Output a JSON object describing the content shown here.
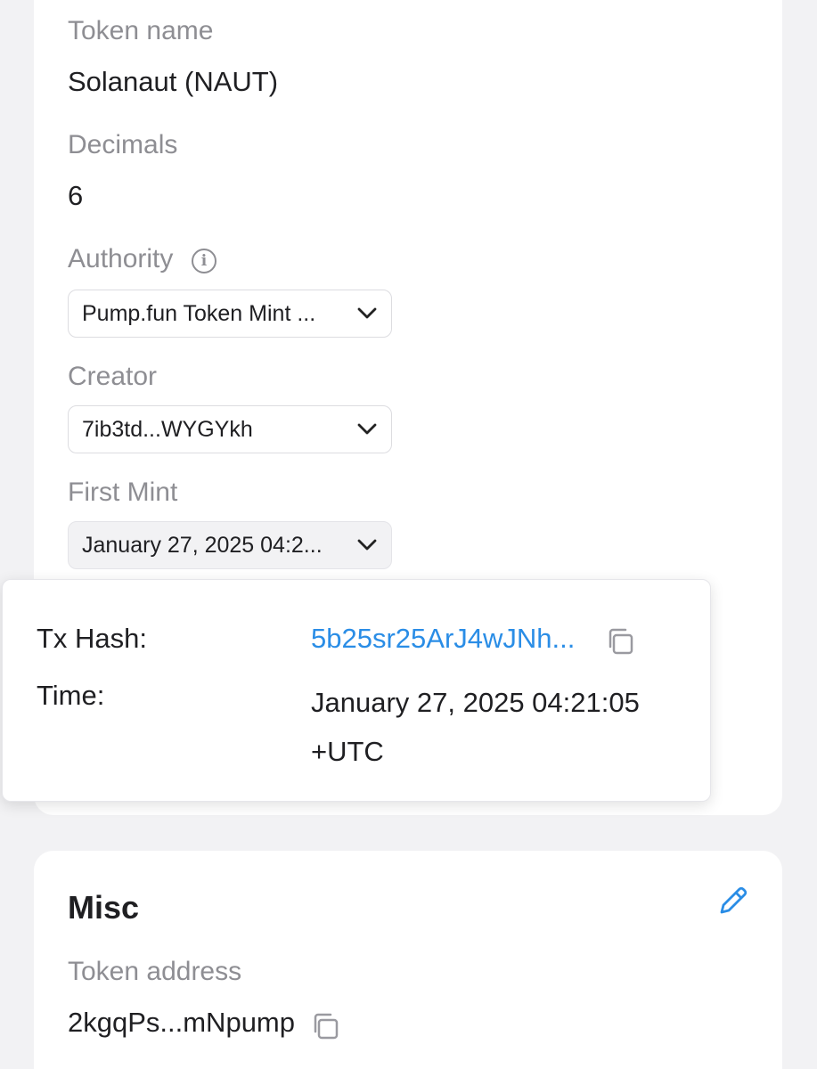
{
  "token_info": {
    "token_name_label": "Token name",
    "token_name_value": "Solanaut (NAUT)",
    "decimals_label": "Decimals",
    "decimals_value": "6",
    "authority_label": "Authority",
    "authority_value": "Pump.fun Token Mint ...",
    "creator_label": "Creator",
    "creator_value": "7ib3td...WYGYkh",
    "first_mint_label": "First Mint",
    "first_mint_value": "January 27, 2025 04:2..."
  },
  "popover": {
    "tx_hash_label": "Tx Hash:",
    "tx_hash_value": "5b25sr25ArJ4wJNh...",
    "time_label": "Time:",
    "time_value_line1": "January 27, 2025 04:21:05",
    "time_value_line2": "+UTC"
  },
  "misc": {
    "title": "Misc",
    "token_address_label": "Token address",
    "token_address_value": "2kgqPs...mNpump"
  },
  "colors": {
    "background": "#f2f2f4",
    "card": "#ffffff",
    "label_gray": "#8e8e93",
    "link_blue": "#2a8de6"
  },
  "icons": [
    "info-icon",
    "chevron-down-icon",
    "copy-icon",
    "edit-icon"
  ]
}
